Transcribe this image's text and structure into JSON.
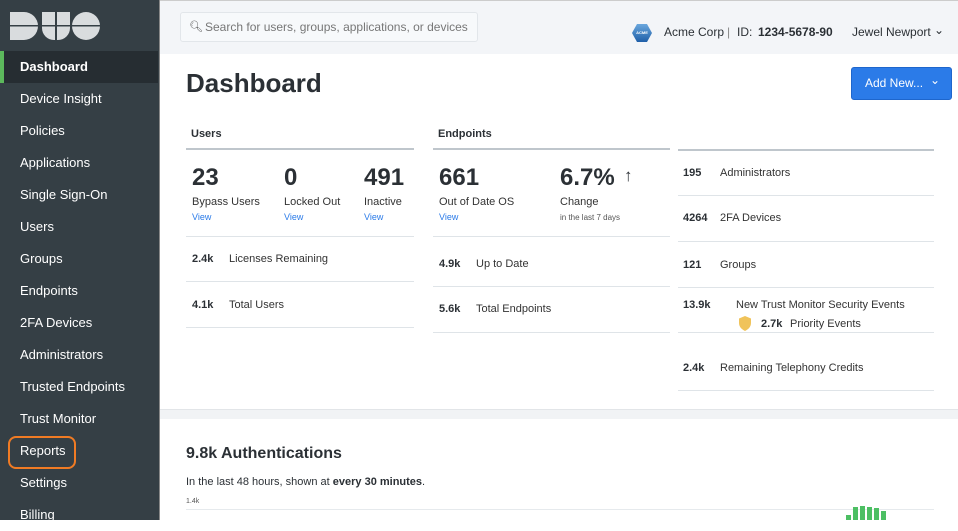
{
  "brand": {
    "logo_text": "DUO"
  },
  "sidebar": {
    "items": [
      {
        "label": "Dashboard"
      },
      {
        "label": "Device Insight"
      },
      {
        "label": "Policies"
      },
      {
        "label": "Applications"
      },
      {
        "label": "Single Sign-On"
      },
      {
        "label": "Users"
      },
      {
        "label": "Groups"
      },
      {
        "label": "Endpoints"
      },
      {
        "label": "2FA Devices"
      },
      {
        "label": "Administrators"
      },
      {
        "label": "Trusted Endpoints"
      },
      {
        "label": "Trust Monitor"
      },
      {
        "label": "Reports"
      },
      {
        "label": "Settings"
      },
      {
        "label": "Billing"
      }
    ]
  },
  "topbar": {
    "search_placeholder": "Search for users, groups, applications, or devices",
    "org_logo_text": "ACME",
    "org": "Acme Corp",
    "sep": "|",
    "id_label": "ID:",
    "id": "1234-5678-90",
    "user": "Jewel Newport"
  },
  "page": {
    "title": "Dashboard",
    "add_new": "Add New..."
  },
  "users": {
    "header": "Users",
    "stats": [
      {
        "value": "23",
        "label": "Bypass Users",
        "link": "View"
      },
      {
        "value": "0",
        "label": "Locked Out",
        "link": "View"
      },
      {
        "value": "491",
        "label": "Inactive",
        "link": "View"
      }
    ],
    "rows": [
      {
        "value": "2.4k",
        "label": "Licenses Remaining"
      },
      {
        "value": "4.1k",
        "label": "Total Users"
      }
    ]
  },
  "endpoints": {
    "header": "Endpoints",
    "stats": [
      {
        "value": "661",
        "label": "Out of Date OS",
        "link": "View"
      },
      {
        "value": "6.7%",
        "arrow": "↑",
        "label": "Change",
        "sub": "in the last 7 days"
      }
    ],
    "rows": [
      {
        "value": "4.9k",
        "label": "Up to Date"
      },
      {
        "value": "5.6k",
        "label": "Total Endpoints"
      }
    ]
  },
  "summary": {
    "rows": [
      {
        "value": "195",
        "label": "Administrators"
      },
      {
        "value": "4264",
        "label": "2FA Devices"
      },
      {
        "value": "121",
        "label": "Groups"
      },
      {
        "value": "13.9k",
        "label": "New Trust Monitor Security Events",
        "sub_value": "2.7k",
        "sub_label": "Priority Events"
      },
      {
        "value": "2.4k",
        "label": "Remaining Telephony Credits"
      }
    ]
  },
  "auth": {
    "title": "9.8k Authentications",
    "subtitle_prefix": "In the last 48 hours, shown at ",
    "subtitle_bold": "every 30 minutes",
    "subtitle_suffix": ".",
    "y_max_label": "1.4k"
  },
  "colors": {
    "accent": "#2b7be8",
    "sidebar": "#353f45",
    "active_marker": "#5cb85c",
    "highlight": "#f07b24",
    "bars": "#4cbf63",
    "shield": "#f0c35a"
  }
}
